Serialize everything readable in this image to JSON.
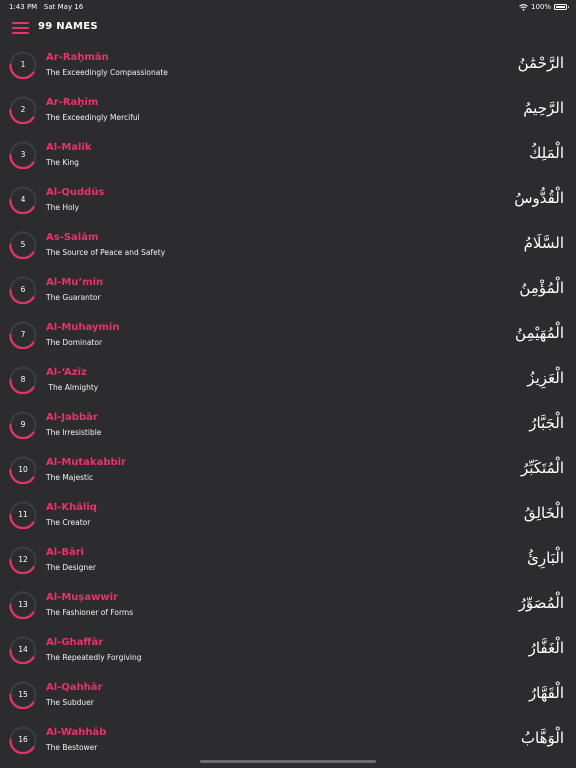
{
  "status_bar": {
    "time": "1:43 PM",
    "date": "Sat May 16",
    "battery": "100%"
  },
  "nav": {
    "title": "99 NAMES"
  },
  "colors": {
    "accent": "#e8336a",
    "background": "#2c2c2e"
  },
  "names": [
    {
      "number": "1",
      "name": "Ar-Raḥmān",
      "meaning": "The Exceedingly Compassionate",
      "arabic": "الرَّحْمَٰنُ"
    },
    {
      "number": "2",
      "name": "Ar-Raḥīm",
      "meaning": "The Exceedingly Merciful",
      "arabic": "الرَّحِيمُ"
    },
    {
      "number": "3",
      "name": "Al-Malik",
      "meaning": "The King",
      "arabic": "الْمَلِكُ"
    },
    {
      "number": "4",
      "name": "Al-Quddūs",
      "meaning": "The Holy",
      "arabic": "الْقُدُّوسُ"
    },
    {
      "number": "5",
      "name": "As-Salām",
      "meaning": "The Source of Peace and Safety",
      "arabic": "السَّلَامُ"
    },
    {
      "number": "6",
      "name": "Al-Mu’min",
      "meaning": "The Guarantor",
      "arabic": "الْمُؤْمِنُ"
    },
    {
      "number": "7",
      "name": "Al-Muhaymin",
      "meaning": "The Dominator",
      "arabic": "الْمُهَيْمِنُ"
    },
    {
      "number": "8",
      "name": "Al-‘Azīz",
      "meaning": " The Almighty",
      "arabic": "الْعَزِيزُ"
    },
    {
      "number": "9",
      "name": "Al-Jabbār",
      "meaning": "The Irresistible",
      "arabic": "الْجَبَّارُ"
    },
    {
      "number": "10",
      "name": "Al-Mutakabbir",
      "meaning": "The Majestic",
      "arabic": "الْمُتَكَبِّرُ"
    },
    {
      "number": "11",
      "name": "Al-Khāliq",
      "meaning": "The Creator",
      "arabic": "الْخَالِقُ"
    },
    {
      "number": "12",
      "name": "Al-Bāri",
      "meaning": "The Designer",
      "arabic": "الْبَارِئُ"
    },
    {
      "number": "13",
      "name": "Al-Muṣawwir",
      "meaning": "The Fashioner of Forms",
      "arabic": "الْمُصَوِّرُ"
    },
    {
      "number": "14",
      "name": "Al-Ghaffār",
      "meaning": "The Repeatedly Forgiving",
      "arabic": "الْغَفَّارُ"
    },
    {
      "number": "15",
      "name": "Al-Qahhār",
      "meaning": "The Subduer",
      "arabic": "الْقَهَّارُ"
    },
    {
      "number": "16",
      "name": "Al-Wahhāb",
      "meaning": "The Bestower",
      "arabic": "الْوَهَّابُ"
    }
  ]
}
